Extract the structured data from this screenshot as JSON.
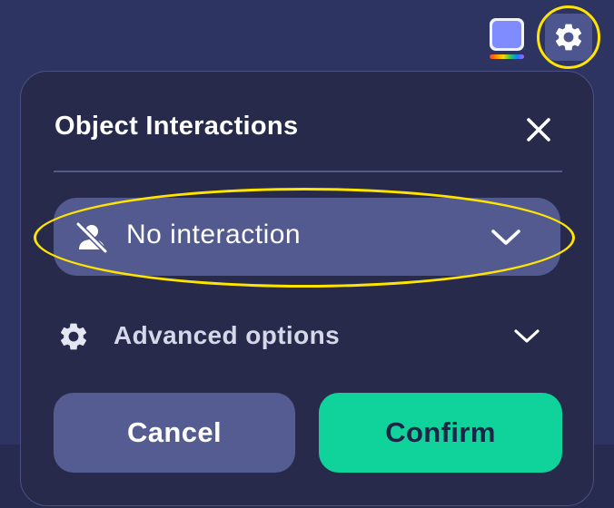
{
  "toolbar": {
    "color_swatch": {
      "color": "#7f8cff",
      "label": "color-picker"
    },
    "settings_icon": "gear-icon"
  },
  "dialog": {
    "title": "Object Interactions",
    "close_icon": "close-icon",
    "interaction_select": {
      "icon": "person-off-icon",
      "value": "No interaction",
      "chevron_icon": "chevron-down-icon"
    },
    "advanced": {
      "icon": "gear-icon",
      "label": "Advanced options",
      "chevron_icon": "chevron-down-icon"
    },
    "buttons": {
      "cancel": "Cancel",
      "confirm": "Confirm"
    }
  },
  "colors": {
    "accent_confirm": "#0fd39b",
    "highlight": "#ffe400",
    "panel_bg": "#272a4b"
  }
}
